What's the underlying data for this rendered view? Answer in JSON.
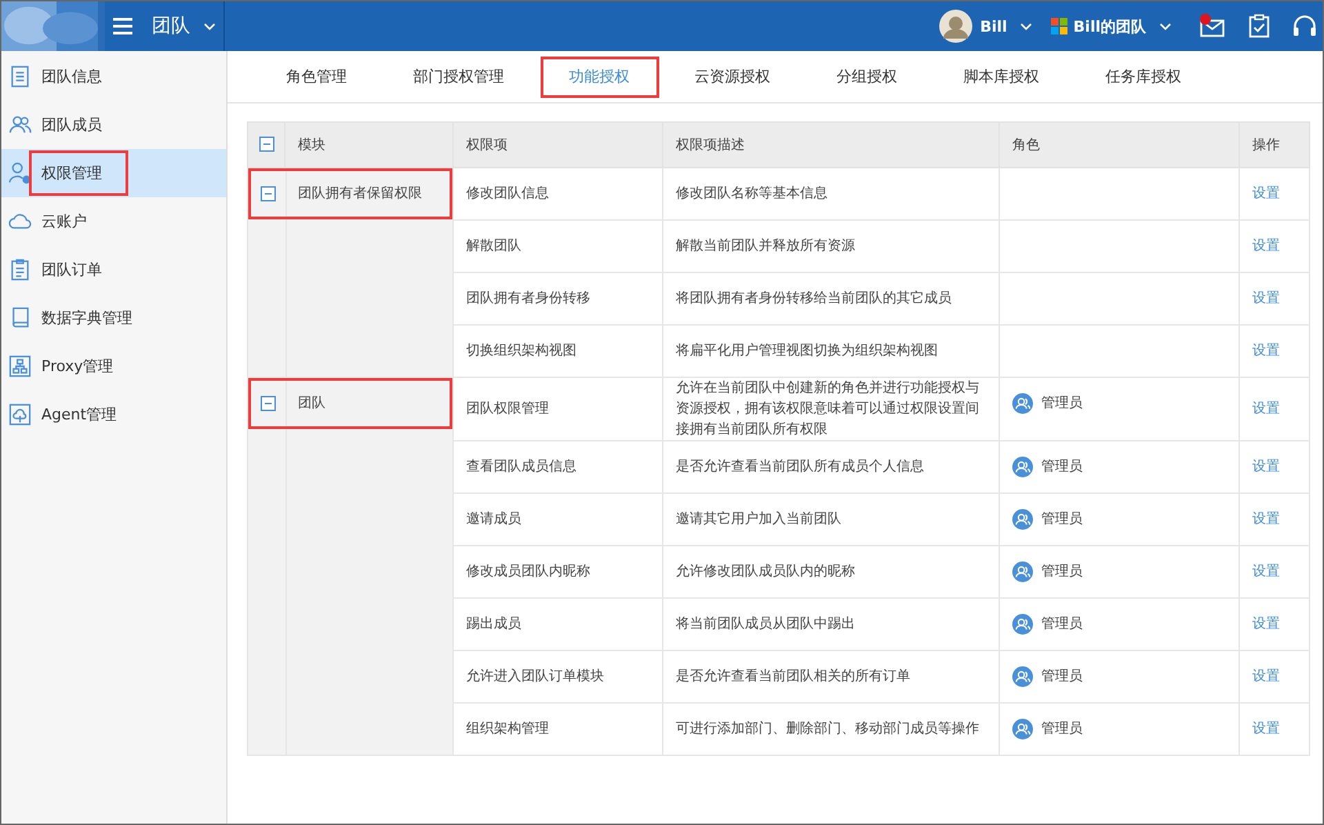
{
  "header": {
    "title": "团队",
    "user": "Bill",
    "team": "Bill的团队",
    "has_unread_mail": true
  },
  "sidebar": {
    "items": [
      {
        "label": "团队信息",
        "kind": "doc",
        "selected": false,
        "highlighted": false
      },
      {
        "label": "团队成员",
        "kind": "users",
        "selected": false,
        "highlighted": false
      },
      {
        "label": "权限管理",
        "kind": "usergear",
        "selected": true,
        "highlighted": true
      },
      {
        "label": "云账户",
        "kind": "cloud",
        "selected": false,
        "highlighted": false
      },
      {
        "label": "团队订单",
        "kind": "clipboard",
        "selected": false,
        "highlighted": false
      },
      {
        "label": "数据字典管理",
        "kind": "book",
        "selected": false,
        "highlighted": false
      },
      {
        "label": "Proxy管理",
        "kind": "network",
        "selected": false,
        "highlighted": false
      },
      {
        "label": "Agent管理",
        "kind": "cloudbox",
        "selected": false,
        "highlighted": false
      }
    ]
  },
  "tabs": [
    {
      "label": "角色管理",
      "selected": false,
      "highlighted": false
    },
    {
      "label": "部门授权管理",
      "selected": false,
      "highlighted": false
    },
    {
      "label": "功能授权",
      "selected": true,
      "highlighted": true
    },
    {
      "label": "云资源授权",
      "selected": false,
      "highlighted": false
    },
    {
      "label": "分组授权",
      "selected": false,
      "highlighted": false
    },
    {
      "label": "脚本库授权",
      "selected": false,
      "highlighted": false
    },
    {
      "label": "任务库授权",
      "selected": false,
      "highlighted": false
    }
  ],
  "table": {
    "columns": [
      "模块",
      "权限项",
      "权限项描述",
      "角色",
      "操作"
    ],
    "groups": [
      {
        "module": "团队拥有者保留权限",
        "expanded": true,
        "highlighted": true,
        "rows": [
          {
            "item": "修改团队信息",
            "description": "修改团队名称等基本信息",
            "action": "设置"
          },
          {
            "item": "解散团队",
            "description": "解散当前团队并释放所有资源",
            "action": "设置"
          },
          {
            "item": "团队拥有者身份转移",
            "description": "将团队拥有者身份转移给当前团队的其它成员",
            "action": "设置"
          },
          {
            "item": "切换组织架构视图",
            "description": "将扁平化用户管理视图切换为组织架构视图",
            "action": "设置"
          }
        ]
      },
      {
        "module": "团队",
        "expanded": true,
        "highlighted": true,
        "rows": [
          {
            "item": "团队权限管理",
            "description": "允许在当前团队中创建新的角色并进行功能授权与资源授权，拥有该权限意味着可以通过权限设置间接拥有当前团队所有权限",
            "role": "管理员",
            "action": "设置"
          },
          {
            "item": "查看团队成员信息",
            "description": "是否允许查看当前团队所有成员个人信息",
            "role": "管理员",
            "action": "设置"
          },
          {
            "item": "邀请成员",
            "description": "邀请其它用户加入当前团队",
            "role": "管理员",
            "action": "设置"
          },
          {
            "item": "修改成员团队内昵称",
            "description": "允许修改团队成员队内的昵称",
            "role": "管理员",
            "action": "设置"
          },
          {
            "item": "踢出成员",
            "description": "将当前团队成员从团队中踢出",
            "role": "管理员",
            "action": "设置"
          },
          {
            "item": "允许进入团队订单模块",
            "description": "是否允许查看当前团队相关的所有订单",
            "role": "管理员",
            "action": "设置"
          },
          {
            "item": "组织架构管理",
            "description": "可进行添加部门、删除部门、移动部门成员等操作",
            "role": "管理员",
            "action": "设置"
          }
        ]
      }
    ]
  }
}
